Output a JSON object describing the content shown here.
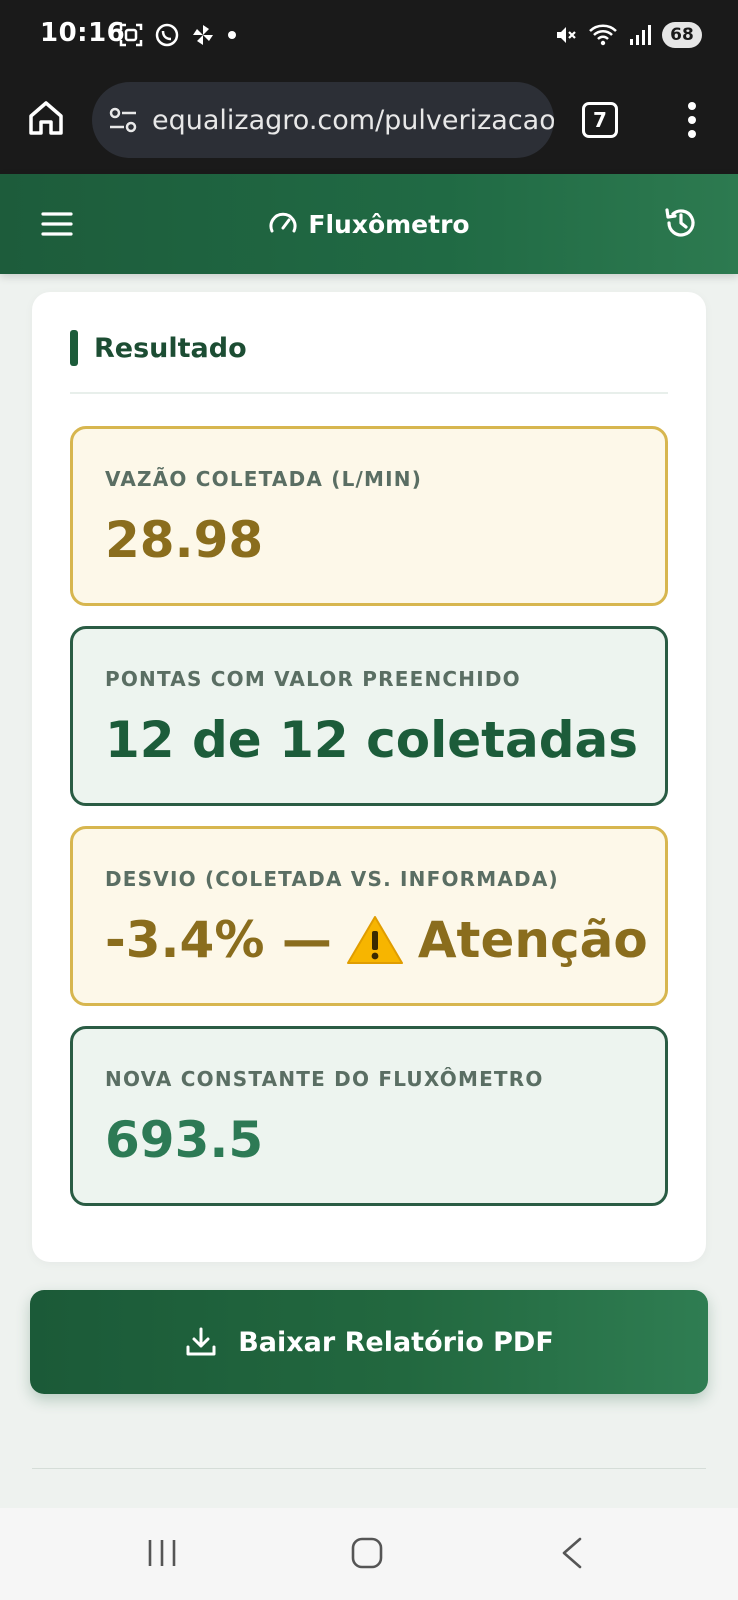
{
  "status_bar": {
    "time": "10:16",
    "battery": "68",
    "left_icons": [
      "screenshot-icon",
      "whatsapp-icon",
      "pinwheel-icon",
      "notification-dot-icon"
    ],
    "right_icons": [
      "mute-icon",
      "wifi-icon",
      "signal-icon",
      "battery-icon"
    ]
  },
  "browser": {
    "url": "equalizagro.com/pulverizacao",
    "tab_count": "7"
  },
  "header": {
    "title": "Fluxômetro"
  },
  "result": {
    "heading": "Resultado",
    "metrics": [
      {
        "label": "VAZÃO COLETADA (L/MIN)",
        "value": "28.98",
        "status": "warn"
      },
      {
        "label": "PONTAS COM VALOR PREENCHIDO",
        "value": "12 de 12 coletadas",
        "status": "ok"
      },
      {
        "label": "DESVIO (COLETADA VS. INFORMADA)",
        "value_main": "-3.4% —",
        "value_status": "Atenção",
        "status": "warn"
      },
      {
        "label": "NOVA CONSTANTE DO FLUXÔMETRO",
        "value": "693.5",
        "status": "ok"
      }
    ]
  },
  "actions": {
    "download_label": "Baixar Relatório PDF"
  },
  "colors": {
    "brand_green": "#1c5c3a",
    "warn_gold": "#8a6d1d",
    "warn_border": "#d7b64f",
    "ok_border": "#2a5c44"
  }
}
